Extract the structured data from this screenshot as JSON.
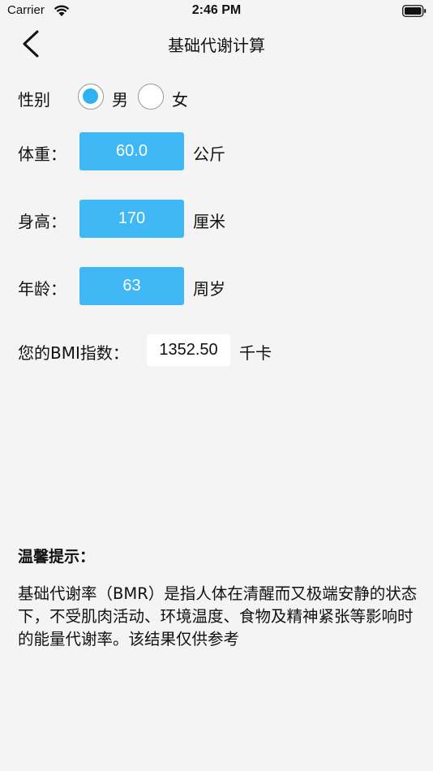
{
  "status_bar": {
    "carrier": "Carrier",
    "time": "2:46 PM"
  },
  "nav": {
    "title": "基础代谢计算"
  },
  "gender": {
    "label": "性别",
    "options": [
      {
        "label": "男",
        "selected": true
      },
      {
        "label": "女",
        "selected": false
      }
    ]
  },
  "weight": {
    "label": "体重：",
    "value": "60.0",
    "unit": "公斤"
  },
  "height": {
    "label": "身高：",
    "value": "170",
    "unit": "厘米"
  },
  "age": {
    "label": "年龄：",
    "value": "63",
    "unit": "周岁"
  },
  "result": {
    "label": "您的BMI指数：",
    "value": "1352.50",
    "unit": "千卡"
  },
  "tip": {
    "title": "温馨提示：",
    "body": "基础代谢率（BMR）是指人体在清醒而又极端安静的状态下，不受肌肉活动、环境温度、食物及精神紧张等影响时的能量代谢率。该结果仅供参考"
  },
  "colors": {
    "accent": "#3fb8f5",
    "radio_fill": "#2fb3f0",
    "background": "#f4f4f4"
  },
  "icons": {
    "back": "chevron-left-icon",
    "wifi": "wifi-icon",
    "battery": "battery-icon"
  }
}
